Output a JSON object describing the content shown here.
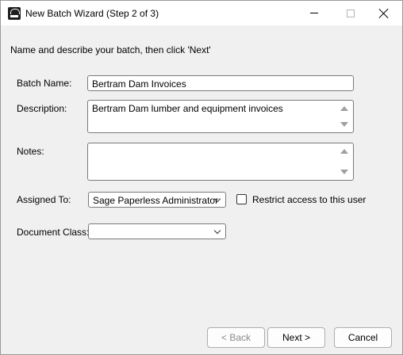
{
  "window": {
    "title": "New Batch Wizard (Step 2 of 3)",
    "icon": "sage-app-icon"
  },
  "instructions": "Name and describe your batch, then click 'Next'",
  "form": {
    "batch_name": {
      "label": "Batch Name:",
      "value": "Bertram Dam Invoices"
    },
    "description": {
      "label": "Description:",
      "value": "Bertram Dam lumber and equipment invoices"
    },
    "notes": {
      "label": "Notes:",
      "value": ""
    },
    "assigned_to": {
      "label": "Assigned To:",
      "value": "Sage Paperless  Administrator"
    },
    "restrict_access": {
      "label": "Restrict access to this user",
      "checked": false
    },
    "document_class": {
      "label": "Document Class:",
      "value": ""
    }
  },
  "buttons": {
    "back": "< Back",
    "next": "Next >",
    "cancel": "Cancel"
  }
}
